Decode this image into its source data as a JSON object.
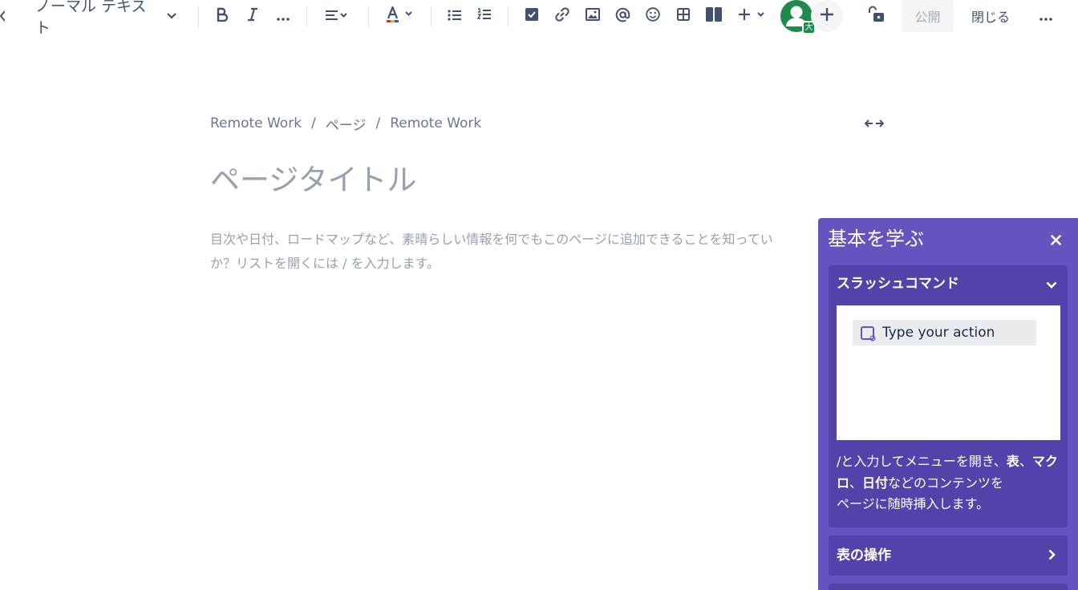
{
  "toolbar": {
    "text_style": "ノーマル テキスト",
    "publish_label": "公開",
    "close_label": "閉じる",
    "avatar_badge": "大"
  },
  "breadcrumb": {
    "items": [
      "Remote Work",
      "ページ",
      "Remote Work"
    ],
    "separator": "/"
  },
  "page": {
    "title_placeholder": "ページタイトル",
    "hint_line1": "目次や日付、ロードマップなど、素晴らしい情報を何でもこのページに追加できることを知ってい",
    "hint_line2": "か？リストを開くには / を入力します。"
  },
  "learn_panel": {
    "title": "基本を学ぶ",
    "sections": [
      {
        "title": "スラッシュコマンド",
        "demo_text": "Type your action",
        "desc_parts": {
          "p1": "/と入力してメニューを開き、",
          "b1": "表",
          "p2": "、",
          "b2": "マクロ",
          "p3": "、",
          "b3": "日付",
          "p4": "などのコンテンツを",
          "p5": "ページに随時挿入します。"
        }
      },
      {
        "title": "表の操作"
      }
    ]
  },
  "colors": {
    "panel_bg": "#6554c0",
    "section_bg": "#5243aa",
    "avatar_bg": "#1f8a4c",
    "toolbar_icon": "#42526e",
    "placeholder_text": "#97a0af"
  },
  "icons": [
    "back-arrow-icon",
    "chevron-down-icon",
    "bold-icon",
    "italic-icon",
    "more-formatting-icon",
    "align-icon",
    "text-color-icon",
    "bullet-list-icon",
    "numbered-list-icon",
    "action-item-icon",
    "link-icon",
    "image-icon",
    "mention-icon",
    "emoji-icon",
    "table-icon",
    "layouts-icon",
    "insert-plus-icon",
    "add-collaborator-icon",
    "restrictions-lock-icon",
    "more-icon",
    "width-toggle-icon",
    "close-icon",
    "chevron-right-icon"
  ]
}
